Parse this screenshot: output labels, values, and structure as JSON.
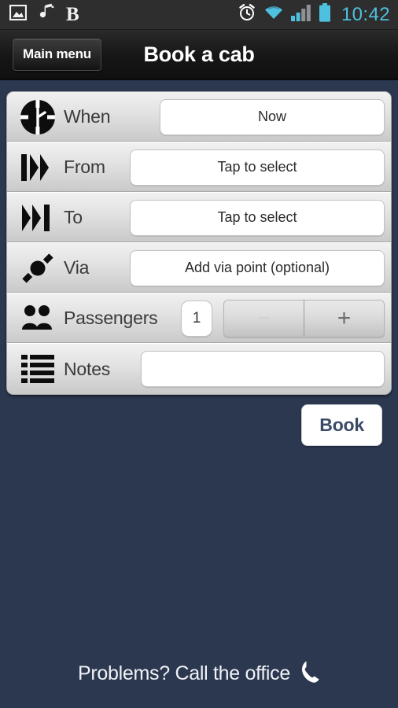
{
  "statusbar": {
    "time": "10:42",
    "left_icons": [
      "image-icon",
      "music-note-icon",
      "b-app-icon"
    ],
    "b_glyph": "B",
    "right_icons": [
      "alarm-clock-icon",
      "wifi-icon",
      "signal-bars-icon",
      "battery-icon"
    ],
    "accent_color": "#4ec0e0",
    "background_color": "#2e2e2e"
  },
  "actionbar": {
    "menu_label": "Main menu",
    "title": "Book a cab"
  },
  "theme": {
    "page_background": "#2b3850",
    "card_background": "#e2e2e2",
    "book_text_color": "#3a4a66"
  },
  "form": {
    "rows": [
      {
        "icon": "clock-icon",
        "label": "When",
        "value": "Now"
      },
      {
        "icon": "from-arrow-icon",
        "label": "From",
        "value": "Tap to select"
      },
      {
        "icon": "to-arrow-icon",
        "label": "To",
        "value": "Tap to select"
      },
      {
        "icon": "via-point-icon",
        "label": "Via",
        "value": "Add via point (optional)"
      },
      {
        "icon": "passengers-icon",
        "label": "Passengers",
        "value": "1"
      },
      {
        "icon": "notes-list-icon",
        "label": "Notes",
        "value": ""
      }
    ],
    "passengers": {
      "count": "1",
      "decrement_label": "−",
      "increment_label": "+",
      "decrement_enabled": false,
      "increment_enabled": true
    },
    "notes_placeholder": ""
  },
  "actions": {
    "book_label": "Book"
  },
  "footer": {
    "text": "Problems? Call the office",
    "icon": "phone-icon"
  }
}
